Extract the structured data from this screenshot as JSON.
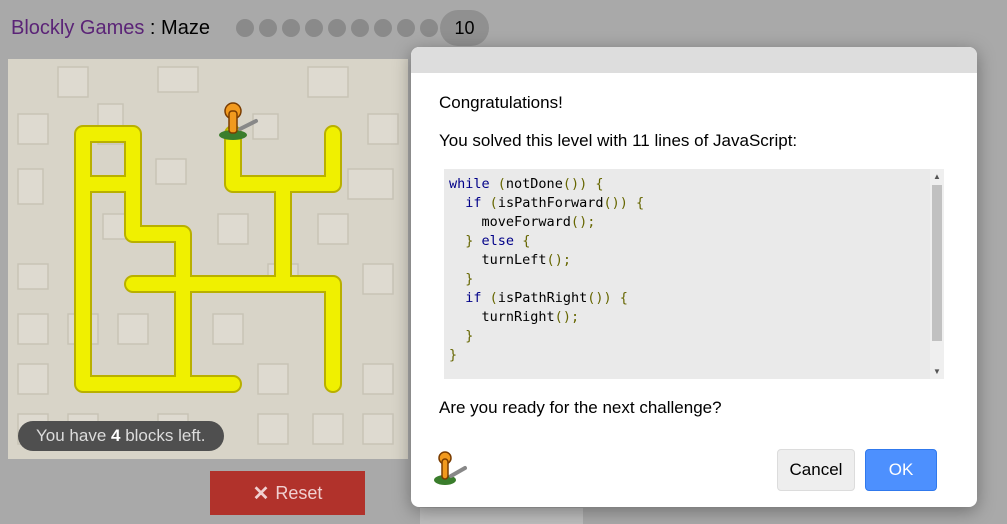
{
  "header": {
    "app_name": "Blockly Games",
    "separator": " : ",
    "game_name": "Maze",
    "levels_completed": 9,
    "current_level": "10"
  },
  "maze": {
    "blocks_left_prefix": "You have ",
    "blocks_left_count": "4",
    "blocks_left_suffix": " blocks left."
  },
  "reset": {
    "label": "Reset",
    "icon": "x-icon"
  },
  "dialog": {
    "congrats": "Congratulations!",
    "solved_text": "You solved this level with 11 lines of JavaScript:",
    "code": "while (notDone()) {\n  if (isPathForward()) {\n    moveForward();\n  } else {\n    turnLeft();\n  }\n  if (isPathRight()) {\n    turnRight();\n  }\n}",
    "next_challenge": "Are you ready for the next challenge?",
    "cancel_label": "Cancel",
    "ok_label": "OK"
  },
  "colors": {
    "path": "#f0f000",
    "brand": "#5b2477",
    "ok_button": "#4d90fe",
    "reset_button": "#b1322b"
  }
}
